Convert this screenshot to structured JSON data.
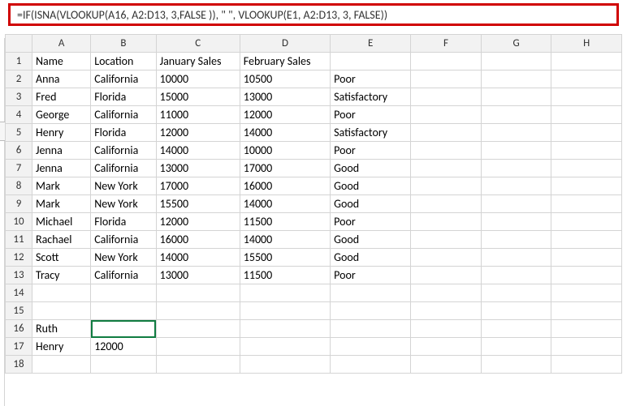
{
  "formula_bar": {
    "value": "=IF(ISNA(VLOOKUP(A16, A2:D13, 3,FALSE )), \" \", VLOOKUP(E1, A2:D13, 3, FALSE))"
  },
  "columns": [
    "A",
    "B",
    "C",
    "D",
    "E",
    "F",
    "G",
    "H"
  ],
  "row_numbers": [
    1,
    2,
    3,
    4,
    5,
    6,
    7,
    8,
    9,
    10,
    11,
    12,
    13,
    14,
    15,
    16,
    17,
    18
  ],
  "selected_cell": "B16",
  "chart_data": {
    "type": "table",
    "title": "",
    "headers": [
      "Name",
      "Location",
      "January Sales",
      "February Sales"
    ],
    "rows": [
      {
        "name": "Anna",
        "location": "California",
        "jan": 10000,
        "feb": 10500,
        "rating": "Poor"
      },
      {
        "name": "Fred",
        "location": "Florida",
        "jan": 15000,
        "feb": 13000,
        "rating": "Satisfactory"
      },
      {
        "name": "George",
        "location": "California",
        "jan": 11000,
        "feb": 12000,
        "rating": "Poor"
      },
      {
        "name": "Henry",
        "location": "Florida",
        "jan": 12000,
        "feb": 14000,
        "rating": "Satisfactory"
      },
      {
        "name": "Jenna",
        "location": "California",
        "jan": 14000,
        "feb": 10000,
        "rating": "Poor"
      },
      {
        "name": "Jenna",
        "location": "California",
        "jan": 13000,
        "feb": 17000,
        "rating": "Good"
      },
      {
        "name": "Mark",
        "location": "New York",
        "jan": 17000,
        "feb": 16000,
        "rating": "Good"
      },
      {
        "name": "Mark",
        "location": "New York",
        "jan": 15500,
        "feb": 14000,
        "rating": "Good"
      },
      {
        "name": "Michael",
        "location": "Florida",
        "jan": 12000,
        "feb": 11500,
        "rating": "Poor"
      },
      {
        "name": "Rachael",
        "location": "California",
        "jan": 16000,
        "feb": 14000,
        "rating": "Good"
      },
      {
        "name": "Scott",
        "location": "New York",
        "jan": 14000,
        "feb": 15500,
        "rating": "Good"
      },
      {
        "name": "Tracy",
        "location": "California",
        "jan": 13000,
        "feb": 11500,
        "rating": "Poor"
      }
    ],
    "lookup_rows": [
      {
        "name": "Ruth",
        "result": ""
      },
      {
        "name": "Henry",
        "result": 12000
      }
    ]
  }
}
